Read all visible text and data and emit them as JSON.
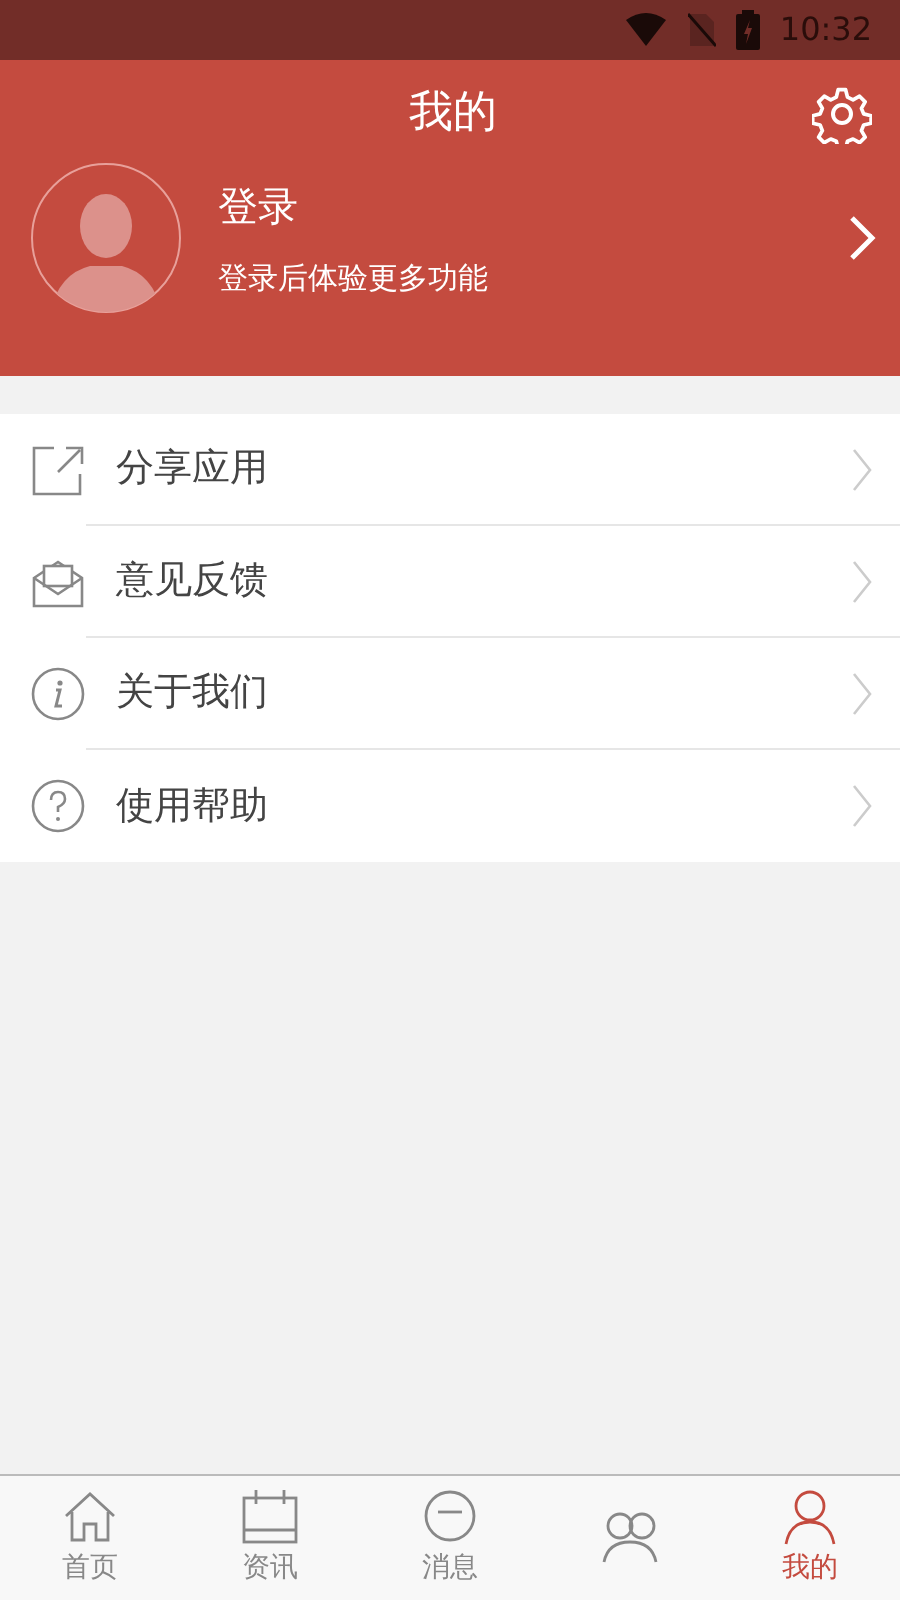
{
  "status_bar": {
    "time": "10:32"
  },
  "header": {
    "title": "我的"
  },
  "profile": {
    "name": "登录",
    "subtitle": "登录后体验更多功能"
  },
  "menu": [
    {
      "kind": "share",
      "label": "分享应用"
    },
    {
      "kind": "feedback",
      "label": "意见反馈"
    },
    {
      "kind": "about",
      "label": "关于我们"
    },
    {
      "kind": "help",
      "label": "使用帮助"
    }
  ],
  "tab_bar": [
    {
      "kind": "home",
      "label": "首页",
      "selected": false
    },
    {
      "kind": "news",
      "label": "资讯",
      "selected": false
    },
    {
      "kind": "message",
      "label": "消息",
      "selected": false
    },
    {
      "kind": "group",
      "selected": false
    },
    {
      "kind": "me",
      "label": "我的",
      "selected": true
    }
  ]
}
